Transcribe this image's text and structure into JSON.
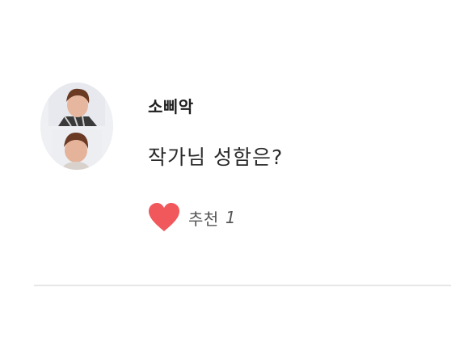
{
  "comment": {
    "author": "소삐악",
    "text": "작가님 성함은?",
    "avatar": {
      "icon": "user-avatar-photo"
    },
    "recommend": {
      "icon": "heart-icon",
      "icon_color": "#f0585c",
      "label": "추천",
      "count": "1"
    }
  }
}
